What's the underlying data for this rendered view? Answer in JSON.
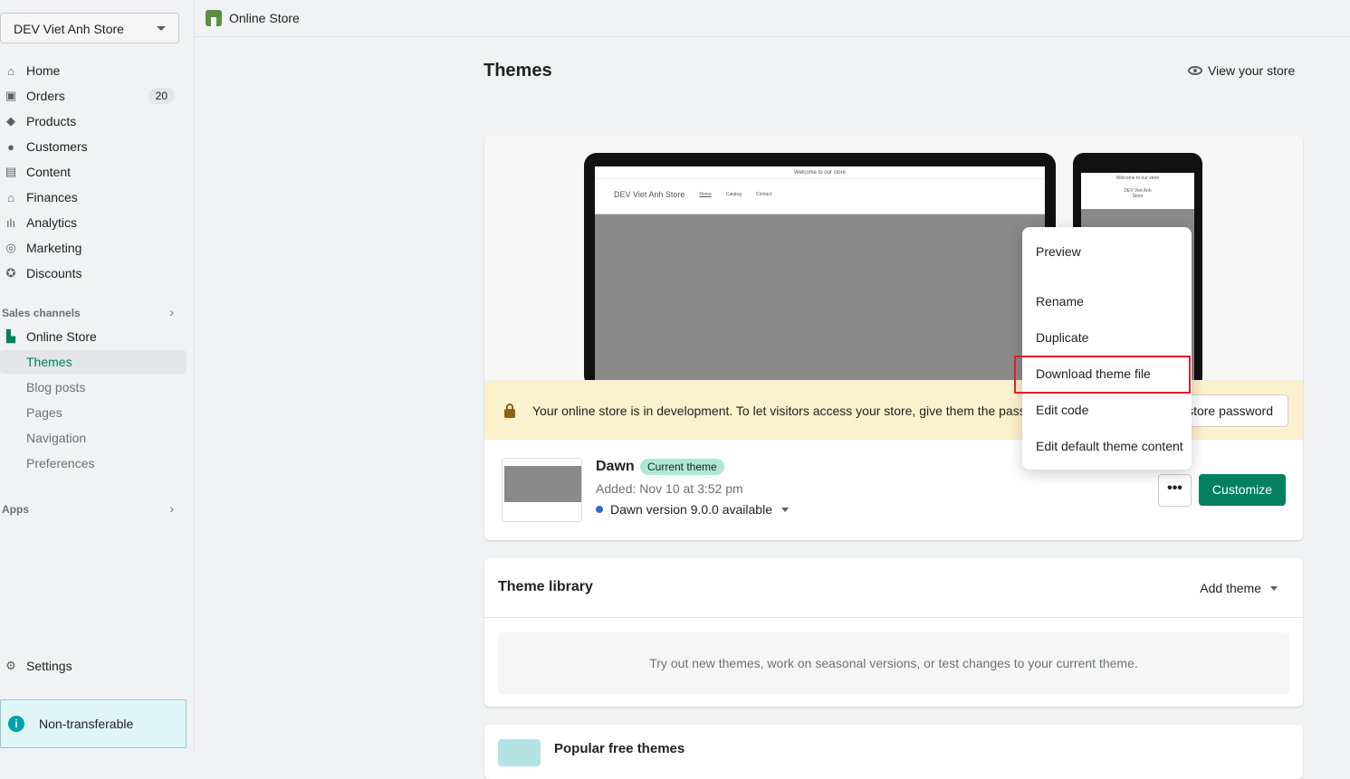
{
  "sidebar": {
    "store": "DEV Viet Anh Store",
    "items": [
      {
        "label": "Home"
      },
      {
        "label": "Orders",
        "badge": "20"
      },
      {
        "label": "Products"
      },
      {
        "label": "Customers"
      },
      {
        "label": "Content"
      },
      {
        "label": "Finances"
      },
      {
        "label": "Analytics"
      },
      {
        "label": "Marketing"
      },
      {
        "label": "Discounts"
      }
    ],
    "sales_channels": "Sales channels",
    "online_store": "Online Store",
    "sub": [
      {
        "label": "Themes"
      },
      {
        "label": "Blog posts"
      },
      {
        "label": "Pages"
      },
      {
        "label": "Navigation"
      },
      {
        "label": "Preferences"
      }
    ],
    "apps": "Apps",
    "settings": "Settings",
    "non_transferable": "Non-transferable"
  },
  "topbar": {
    "title": "Online Store"
  },
  "page": {
    "title": "Themes",
    "view_store": "View your store"
  },
  "preview": {
    "announcement": "Welcome to our store",
    "store_name": "DEV Viet Anh Store",
    "nav": [
      "Home",
      "Catalog",
      "Contact"
    ],
    "mobile_store_name": "DEV Viet Anh Store"
  },
  "banner": {
    "text": "Your online store is in development. To let visitors access your store, give them the password",
    "button": "store password"
  },
  "theme": {
    "name": "Dawn",
    "badge": "Current theme",
    "added": "Added: Nov 10 at 3:52 pm",
    "version": "Dawn version 9.0.0 available",
    "more": "•••",
    "customize": "Customize"
  },
  "menu": [
    "Preview",
    "Rename",
    "Duplicate",
    "Download theme file",
    "Edit code",
    "Edit default theme content"
  ],
  "library": {
    "title": "Theme library",
    "add": "Add theme",
    "empty": "Try out new themes, work on seasonal versions, or test changes to your current theme."
  },
  "popular": {
    "title": "Popular free themes"
  }
}
